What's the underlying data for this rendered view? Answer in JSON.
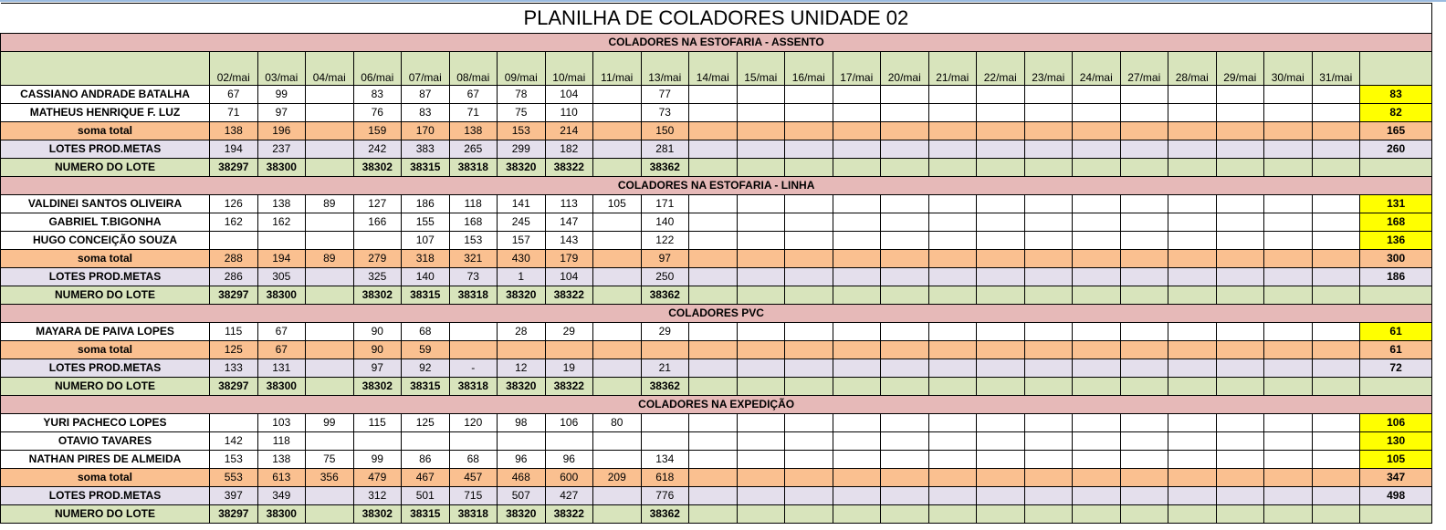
{
  "title": "PLANILHA DE COLADORES UNIDADE 02",
  "columns": [
    "02/mai",
    "03/mai",
    "04/mai",
    "06/mai",
    "07/mai",
    "08/mai",
    "09/mai",
    "10/mai",
    "11/mai",
    "13/mai",
    "14/mai",
    "15/mai",
    "16/mai",
    "17/mai",
    "20/mai",
    "21/mai",
    "22/mai",
    "23/mai",
    "24/mai",
    "27/mai",
    "28/mai",
    "29/mai",
    "30/mai",
    "31/mai"
  ],
  "sections": [
    {
      "title": "COLADORES NA ESTOFARIA - ASSENTO",
      "header": true,
      "rows": [
        {
          "type": "person",
          "name": "CASSIANO ANDRADE BATALHA",
          "values": [
            "67",
            "99",
            "",
            "83",
            "87",
            "67",
            "78",
            "104",
            "",
            "77"
          ],
          "total": "83"
        },
        {
          "type": "person",
          "name": "MATHEUS HENRIQUE F. LUZ",
          "values": [
            "71",
            "97",
            "",
            "76",
            "83",
            "71",
            "75",
            "110",
            "",
            "73"
          ],
          "total": "82"
        },
        {
          "type": "soma",
          "name": "soma total",
          "values": [
            "138",
            "196",
            "",
            "159",
            "170",
            "138",
            "153",
            "214",
            "",
            "150"
          ],
          "total": "165"
        },
        {
          "type": "lotes",
          "name": "LOTES PROD.METAS",
          "values": [
            "194",
            "237",
            "",
            "242",
            "383",
            "265",
            "299",
            "182",
            "",
            "281"
          ],
          "total": "260"
        },
        {
          "type": "numero",
          "name": "NUMERO DO LOTE",
          "values": [
            "38297",
            "38300",
            "",
            "38302",
            "38315",
            "38318",
            "38320",
            "38322",
            "",
            "38362"
          ],
          "total": ""
        }
      ]
    },
    {
      "title": "COLADORES NA ESTOFARIA - LINHA",
      "header": false,
      "rows": [
        {
          "type": "person",
          "name": "VALDINEI SANTOS OLIVEIRA",
          "values": [
            "126",
            "138",
            "89",
            "127",
            "186",
            "118",
            "141",
            "113",
            "105",
            "171"
          ],
          "total": "131"
        },
        {
          "type": "person",
          "name": "GABRIEL T.BIGONHA",
          "values": [
            "162",
            "162",
            "",
            "166",
            "155",
            "168",
            "245",
            "147",
            "",
            "140"
          ],
          "total": "168"
        },
        {
          "type": "person",
          "name": "HUGO CONCEIÇÃO SOUZA",
          "values": [
            "",
            "",
            "",
            "",
            "107",
            "153",
            "157",
            "143",
            "",
            "122"
          ],
          "total": "136"
        },
        {
          "type": "soma",
          "name": "soma total",
          "values": [
            "288",
            "194",
            "89",
            "279",
            "318",
            "321",
            "430",
            "179",
            "",
            "97"
          ],
          "total": "300"
        },
        {
          "type": "lotes",
          "name": "LOTES PROD.METAS",
          "values": [
            "286",
            "305",
            "",
            "325",
            "140",
            "73",
            "1",
            "104",
            "",
            "250"
          ],
          "total": "186"
        },
        {
          "type": "numero",
          "name": "NUMERO DO LOTE",
          "values": [
            "38297",
            "38300",
            "",
            "38302",
            "38315",
            "38318",
            "38320",
            "38322",
            "",
            "38362"
          ],
          "total": ""
        }
      ]
    },
    {
      "title": "COLADORES PVC",
      "header": false,
      "rows": [
        {
          "type": "person",
          "name": "MAYARA DE PAIVA LOPES",
          "values": [
            "115",
            "67",
            "",
            "90",
            "68",
            "",
            "28",
            "29",
            "",
            "29"
          ],
          "total": "61"
        },
        {
          "type": "soma",
          "name": "soma total",
          "values": [
            "125",
            "67",
            "",
            "90",
            "59",
            "",
            "",
            "",
            "",
            ""
          ],
          "total": "61"
        },
        {
          "type": "lotes",
          "name": "LOTES PROD.METAS",
          "values": [
            "133",
            "131",
            "",
            "97",
            "92",
            "-",
            "12",
            "19",
            "",
            "21"
          ],
          "total": "72"
        },
        {
          "type": "numero",
          "name": "NUMERO DO LOTE",
          "values": [
            "38297",
            "38300",
            "",
            "38302",
            "38315",
            "38318",
            "38320",
            "38322",
            "",
            "38362"
          ],
          "total": ""
        }
      ]
    },
    {
      "title": "COLADORES NA EXPEDIÇÃO",
      "header": false,
      "rows": [
        {
          "type": "person",
          "name": "YURI PACHECO LOPES",
          "values": [
            "",
            "103",
            "99",
            "115",
            "125",
            "120",
            "98",
            "106",
            "80",
            ""
          ],
          "total": "106"
        },
        {
          "type": "person",
          "name": "OTAVIO TAVARES",
          "values": [
            "142",
            "118",
            "",
            "",
            "",
            "",
            "",
            "",
            "",
            ""
          ],
          "total": "130"
        },
        {
          "type": "person",
          "name": "NATHAN PIRES DE ALMEIDA",
          "values": [
            "153",
            "138",
            "75",
            "99",
            "86",
            "68",
            "96",
            "96",
            "",
            "134"
          ],
          "total": "105"
        },
        {
          "type": "soma",
          "name": "soma total",
          "values": [
            "553",
            "613",
            "356",
            "479",
            "467",
            "457",
            "468",
            "600",
            "209",
            "618"
          ],
          "total": "347"
        },
        {
          "type": "lotes",
          "name": "LOTES PROD.METAS",
          "values": [
            "397",
            "349",
            "",
            "312",
            "501",
            "715",
            "507",
            "427",
            "",
            "776"
          ],
          "total": "498"
        },
        {
          "type": "numero",
          "name": "NUMERO DO LOTE",
          "values": [
            "38297",
            "38300",
            "",
            "38302",
            "38315",
            "38318",
            "38320",
            "38322",
            "",
            "38362"
          ],
          "total": ""
        }
      ]
    }
  ]
}
